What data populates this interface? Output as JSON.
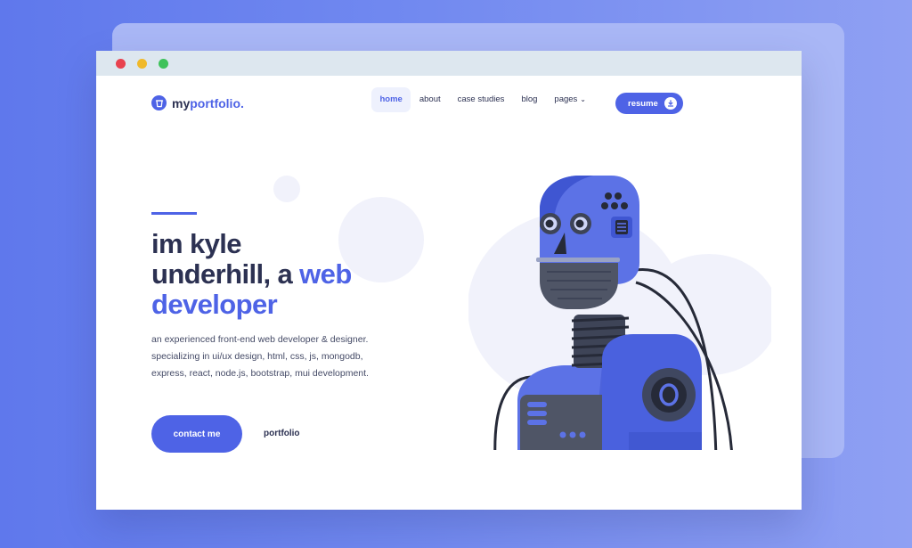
{
  "window": {
    "controls": [
      "close",
      "minimize",
      "maximize"
    ]
  },
  "logo": {
    "prefix": "my",
    "accent": "portfolio.",
    "icon": "cup-icon"
  },
  "nav": {
    "items": [
      {
        "label": "home",
        "active": true
      },
      {
        "label": "about",
        "active": false
      },
      {
        "label": "case studies",
        "active": false
      },
      {
        "label": "blog",
        "active": false
      },
      {
        "label": "pages",
        "active": false,
        "has_dropdown": true
      }
    ],
    "resume_label": "resume",
    "resume_icon": "download-icon"
  },
  "hero": {
    "title_line1": "im kyle",
    "title_line2": "underhill, a ",
    "title_line2_accent": "web",
    "title_line3_accent": "developer",
    "description": "an experienced front-end web developer & designer. specializing in ui/ux design, html, css, js, mongodb, express, react, node.js, bootstrap, mui development.",
    "contact_label": "contact me",
    "portfolio_label": "portfolio"
  },
  "illustration": "robot-illustration",
  "colors": {
    "accent": "#4e63e6",
    "text_dark": "#2c3152",
    "background_gradient_start": "#5f78ec",
    "background_gradient_end": "#8fa0f3"
  }
}
